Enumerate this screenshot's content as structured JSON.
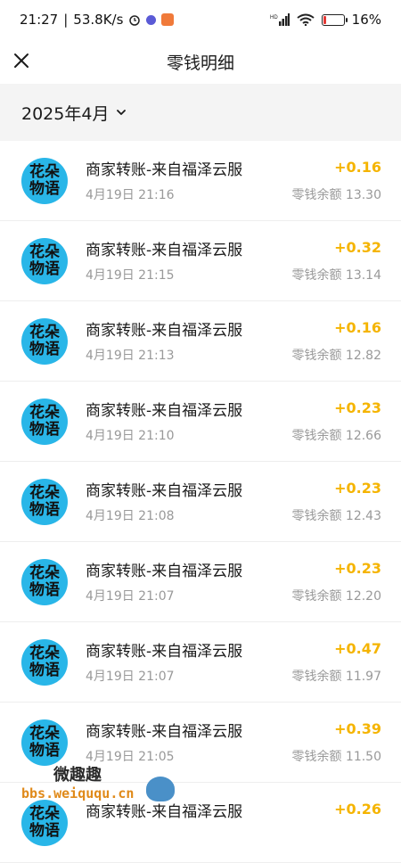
{
  "status_bar": {
    "time": "21:27",
    "speed": "53.8K/s",
    "battery_percent": "16%",
    "battery_level": 0.16,
    "icons": [
      "alarm-icon",
      "app-notification-icon",
      "gift-app-icon",
      "hd-icon",
      "cellular-signal-icon",
      "wifi-icon",
      "battery-icon"
    ]
  },
  "nav": {
    "title": "零钱明细",
    "close_icon": "close-icon"
  },
  "month_filter": {
    "label": "2025年4月",
    "icon": "chevron-down-icon"
  },
  "transactions": [
    {
      "avatar_line1": "花朵",
      "avatar_line2": "物语",
      "title": "商家转账-来自福泽云服",
      "time": "4月19日 21:16",
      "amount": "+0.16",
      "balance": "零钱余额 13.30"
    },
    {
      "avatar_line1": "花朵",
      "avatar_line2": "物语",
      "title": "商家转账-来自福泽云服",
      "time": "4月19日 21:15",
      "amount": "+0.32",
      "balance": "零钱余额 13.14"
    },
    {
      "avatar_line1": "花朵",
      "avatar_line2": "物语",
      "title": "商家转账-来自福泽云服",
      "time": "4月19日 21:13",
      "amount": "+0.16",
      "balance": "零钱余额 12.82"
    },
    {
      "avatar_line1": "花朵",
      "avatar_line2": "物语",
      "title": "商家转账-来自福泽云服",
      "time": "4月19日 21:10",
      "amount": "+0.23",
      "balance": "零钱余额 12.66"
    },
    {
      "avatar_line1": "花朵",
      "avatar_line2": "物语",
      "title": "商家转账-来自福泽云服",
      "time": "4月19日 21:08",
      "amount": "+0.23",
      "balance": "零钱余额 12.43"
    },
    {
      "avatar_line1": "花朵",
      "avatar_line2": "物语",
      "title": "商家转账-来自福泽云服",
      "time": "4月19日 21:07",
      "amount": "+0.23",
      "balance": "零钱余额 12.20"
    },
    {
      "avatar_line1": "花朵",
      "avatar_line2": "物语",
      "title": "商家转账-来自福泽云服",
      "time": "4月19日 21:07",
      "amount": "+0.47",
      "balance": "零钱余额 11.97"
    },
    {
      "avatar_line1": "花朵",
      "avatar_line2": "物语",
      "title": "商家转账-来自福泽云服",
      "time": "4月19日 21:05",
      "amount": "+0.39",
      "balance": "零钱余额 11.50"
    },
    {
      "avatar_line1": "花朵",
      "avatar_line2": "物语",
      "title": "商家转账-来自福泽云服",
      "time": "",
      "amount": "+0.26",
      "balance": ""
    }
  ],
  "watermark": {
    "name": "微趣趣",
    "url": "bbs.weiququ.cn"
  },
  "colors": {
    "amount": "#f5b400",
    "avatar_bg": "#29b6e8",
    "month_bar_bg": "#f4f4f4",
    "secondary_text": "#999999",
    "battery_low": "#e53935"
  }
}
